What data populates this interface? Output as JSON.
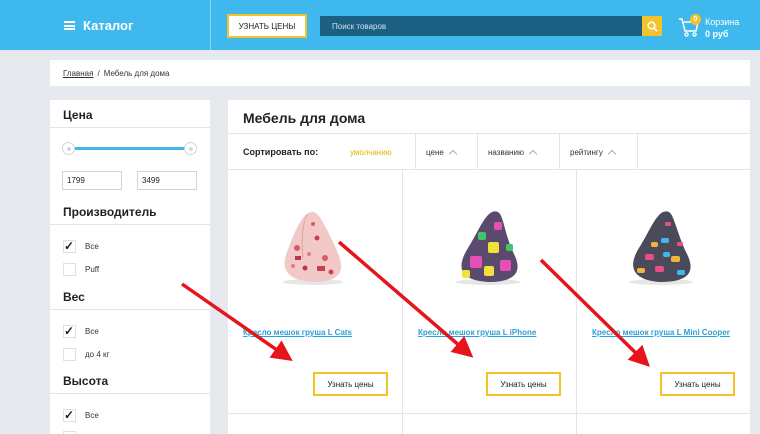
{
  "header": {
    "catalog_label": "Каталог",
    "price_button": "УЗНАТЬ ЦЕНЫ",
    "search_placeholder": "Поиск товаров",
    "cart_count": "0",
    "cart_label": "Корзина",
    "cart_sum": "0 руб"
  },
  "breadcrumb": {
    "home": "Главная",
    "separator": "/",
    "current": "Мебель для дома"
  },
  "sidebar": {
    "price_title": "Цена",
    "price_min": "1799",
    "price_max": "3499",
    "manufacturer_title": "Производитель",
    "manufacturer_options": [
      {
        "label": "Все",
        "checked": true
      },
      {
        "label": "Puff",
        "checked": false
      }
    ],
    "weight_title": "Вес",
    "weight_options": [
      {
        "label": "Все",
        "checked": true
      },
      {
        "label": "до 4 кг",
        "checked": false
      }
    ],
    "height_title": "Высота",
    "height_options": [
      {
        "label": "Все",
        "checked": true
      }
    ]
  },
  "main": {
    "title": "Мебель для дома",
    "sort_label": "Сортировать по:",
    "sort_options": [
      "умолчанию",
      "цене",
      "названию",
      "рейтингу"
    ],
    "products": [
      {
        "name": "Кресло мешок груша L Cats",
        "button": "Узнать цены",
        "icon": "beanbag-cats-image"
      },
      {
        "name": "Кресло мешок груша L iPhone",
        "button": "Узнать цены",
        "icon": "beanbag-iphone-image"
      },
      {
        "name": "Кресло мешок груша L Mini Cooper",
        "button": "Узнать цены",
        "icon": "beanbag-mini-cooper-image"
      }
    ]
  },
  "colors": {
    "header": "#3fb8ee",
    "accent": "#f4c22b",
    "search": "#1b5f83",
    "link": "#2a9fd8",
    "arrow": "#e8141c"
  }
}
